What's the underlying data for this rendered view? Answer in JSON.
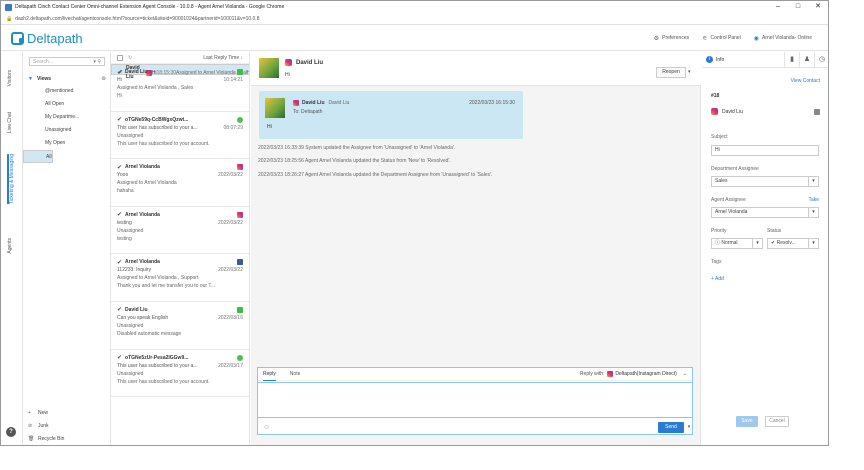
{
  "window": {
    "title": "Deltapath Cinch Contact Center Omni-channel Extension Agent Console - 10.0.8 - Agent Arnel Violanda - Google Chrome",
    "url": "dash2.deltapath.com/livechat/agentconsole.html?source=ticket&siteid=90001024&partnerid=100011&v=10.0.8"
  },
  "header": {
    "logo": "Deltapath",
    "preferences": "Preferences",
    "control_panel": "Control Panel",
    "agent_status": "Arnel Violanda- Online"
  },
  "side_nav": {
    "visitors": "Visitors",
    "live_chat": "Live Chat",
    "ticketing": "Ticketing & Messaging",
    "agents": "Agents"
  },
  "views": {
    "search_placeholder": "Search...",
    "heading": "Views",
    "items": [
      "@mentioned",
      "All Open",
      "My Departme...",
      "Unassigned",
      "My Open",
      "All"
    ],
    "bottom": {
      "new": "New",
      "junk": "Junk",
      "recycle": "Recycle Bin"
    }
  },
  "list": {
    "sort_label": "Last Reply Time",
    "items": [
      {
        "name": "David Liu",
        "msg": "Hi",
        "time": "18:15:30",
        "assign": "Assigned to Arnel Violanda , Sales",
        "preview": "Hi",
        "channel": "ig"
      },
      {
        "name": "David Liu",
        "msg": "Hi",
        "time": "10:14:21",
        "assign": "Assigned to Arnel Violanda , Sales",
        "preview": "Hi",
        "channel": "ln"
      },
      {
        "name": "oTGNe59q-CcBWgxQzwt...",
        "msg": "This user has subscribed to your a...",
        "time": "08:07:29",
        "assign": "Unassigned",
        "preview": "This user has subscribed to your account.",
        "channel": "sm"
      },
      {
        "name": "Arnel Violanda",
        "msg": "Yooo",
        "time": "2022/03/22",
        "assign": "Assigned to Arnel Violanda",
        "preview": "hahaha",
        "channel": "ig"
      },
      {
        "name": "Arnel Violanda",
        "msg": "testing",
        "time": "2022/03/22",
        "assign": "Unassigned",
        "preview": "testing",
        "channel": "ig"
      },
      {
        "name": "Arnel Violanda",
        "msg": "112233: Inquiry",
        "time": "2022/03/22",
        "assign": "Assigned to Arnel Violanda , Support",
        "preview": "Thank you and let me transfer you to our T...",
        "channel": "fb"
      },
      {
        "name": "David Liu",
        "msg": "Can you speak English",
        "time": "2022/03/16",
        "assign": "Unassigned",
        "preview": "Disabled automatic message",
        "channel": "ln"
      },
      {
        "name": "oTGNe5zUr-Pesa2IGGw9...",
        "msg": "This user has subscribed to your a...",
        "time": "2022/03/17",
        "assign": "Unassigned",
        "preview": "This user has subscribed to your account.",
        "channel": "sm"
      }
    ]
  },
  "conversation": {
    "name": "David Liu",
    "msg": "Hi",
    "reopen": "Reopen",
    "bubble": {
      "name": "David Liu",
      "name2": "David Liu",
      "to": "To: Deltapath",
      "date": "2022/03/23 16:15:30",
      "body": "Hi"
    },
    "log": [
      "2022/03/23 16:33:39 System updated the Assignee from 'Unassigned' to 'Arnel Violanda'.",
      "2022/03/23 18:25:56 Agent Arnel Violanda updated the Status from 'New' to 'Resolved'.",
      "2022/03/23 18:26:27 Agent Arnel Violanda updated the Department Assignee from 'Unassigned' to 'Sales'."
    ],
    "reply": {
      "tab_reply": "Reply",
      "tab_note": "Note",
      "reply_with": "Reply with:",
      "channel": "Deltapath(Instagram Direct)",
      "send": "Send"
    }
  },
  "info": {
    "tab": "Info",
    "view_contact": "View Contact",
    "ticket_id": "#18",
    "customer": "David Liu",
    "subject_label": "Subject",
    "subject": "Hi",
    "dept_label": "Department Assignee",
    "dept": "Sales",
    "agent_label": "Agent Assignee",
    "take": "Take",
    "agent": "Arnel Violanda",
    "priority_label": "Priority",
    "priority": "Normal",
    "status_label": "Status",
    "status": "Resolv...",
    "tags_label": "Tags",
    "add": "+ Add",
    "save": "Save",
    "cancel": "Cancel"
  }
}
